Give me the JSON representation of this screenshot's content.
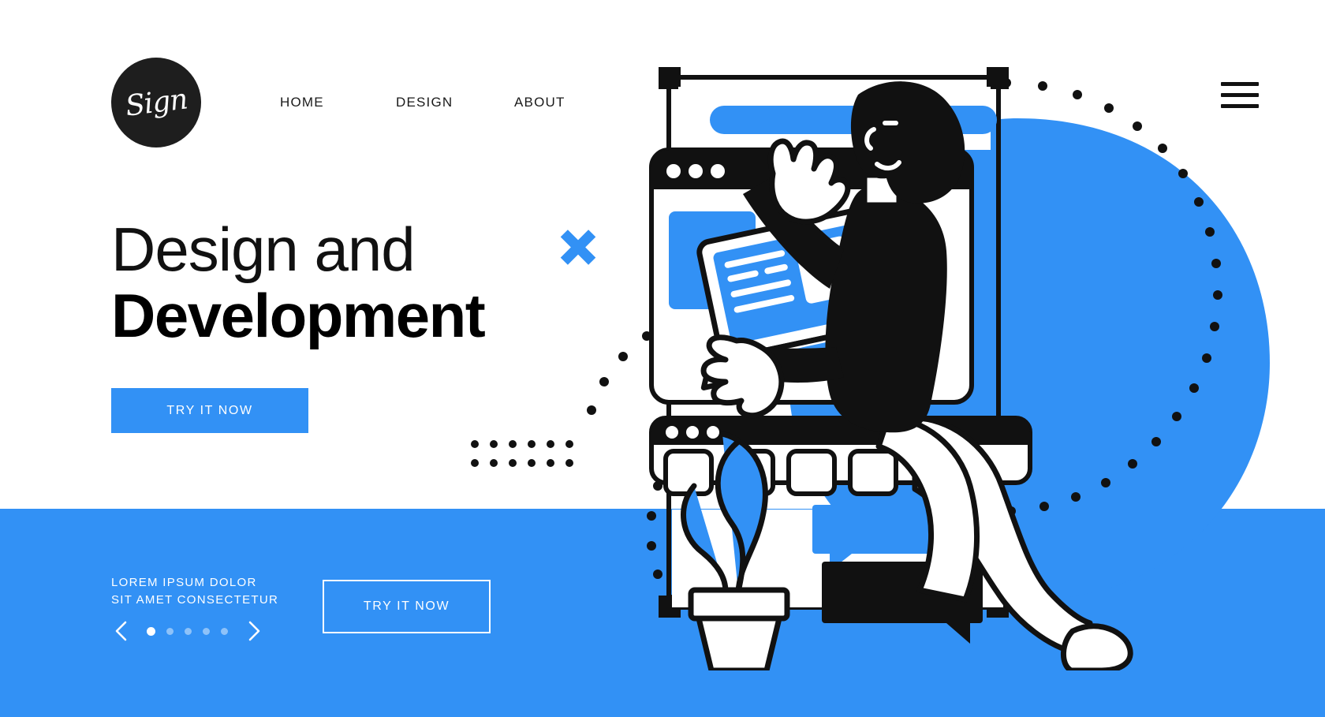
{
  "brand": {
    "logo_text": "Sign"
  },
  "nav": {
    "items": [
      {
        "label": "HOME"
      },
      {
        "label": "DESIGN"
      },
      {
        "label": "ABOUT"
      }
    ],
    "menu_icon": "hamburger-icon"
  },
  "hero": {
    "title_light": "Design and",
    "title_bold": "Development",
    "cta_label": "TRY IT NOW"
  },
  "footer": {
    "tagline_line1": "LOREM IPSUM DOLOR",
    "tagline_line2": "SIT AMET CONSECTETUR",
    "cta_label": "TRY IT NOW",
    "carousel": {
      "prev_icon": "chevron-left-icon",
      "next_icon": "chevron-right-icon",
      "dot_count": 5,
      "active_index": 0
    }
  },
  "decorations": {
    "cross_icon": "cross-icon",
    "dot_grid_rows": 2,
    "dot_grid_cols": 6
  },
  "colors": {
    "accent_blue": "#3291F5",
    "ink": "#111111",
    "white": "#FFFFFF",
    "logo_bg": "#1E1E1E"
  },
  "illustration": {
    "name": "developer-at-browser-windows",
    "elements": [
      "browser-window-top",
      "browser-window-bottom",
      "laptop",
      "potted-plant",
      "speech-bubble-blue",
      "speech-bubble-black",
      "person-figure",
      "blue-circle-backdrop",
      "dotted-arc"
    ]
  }
}
